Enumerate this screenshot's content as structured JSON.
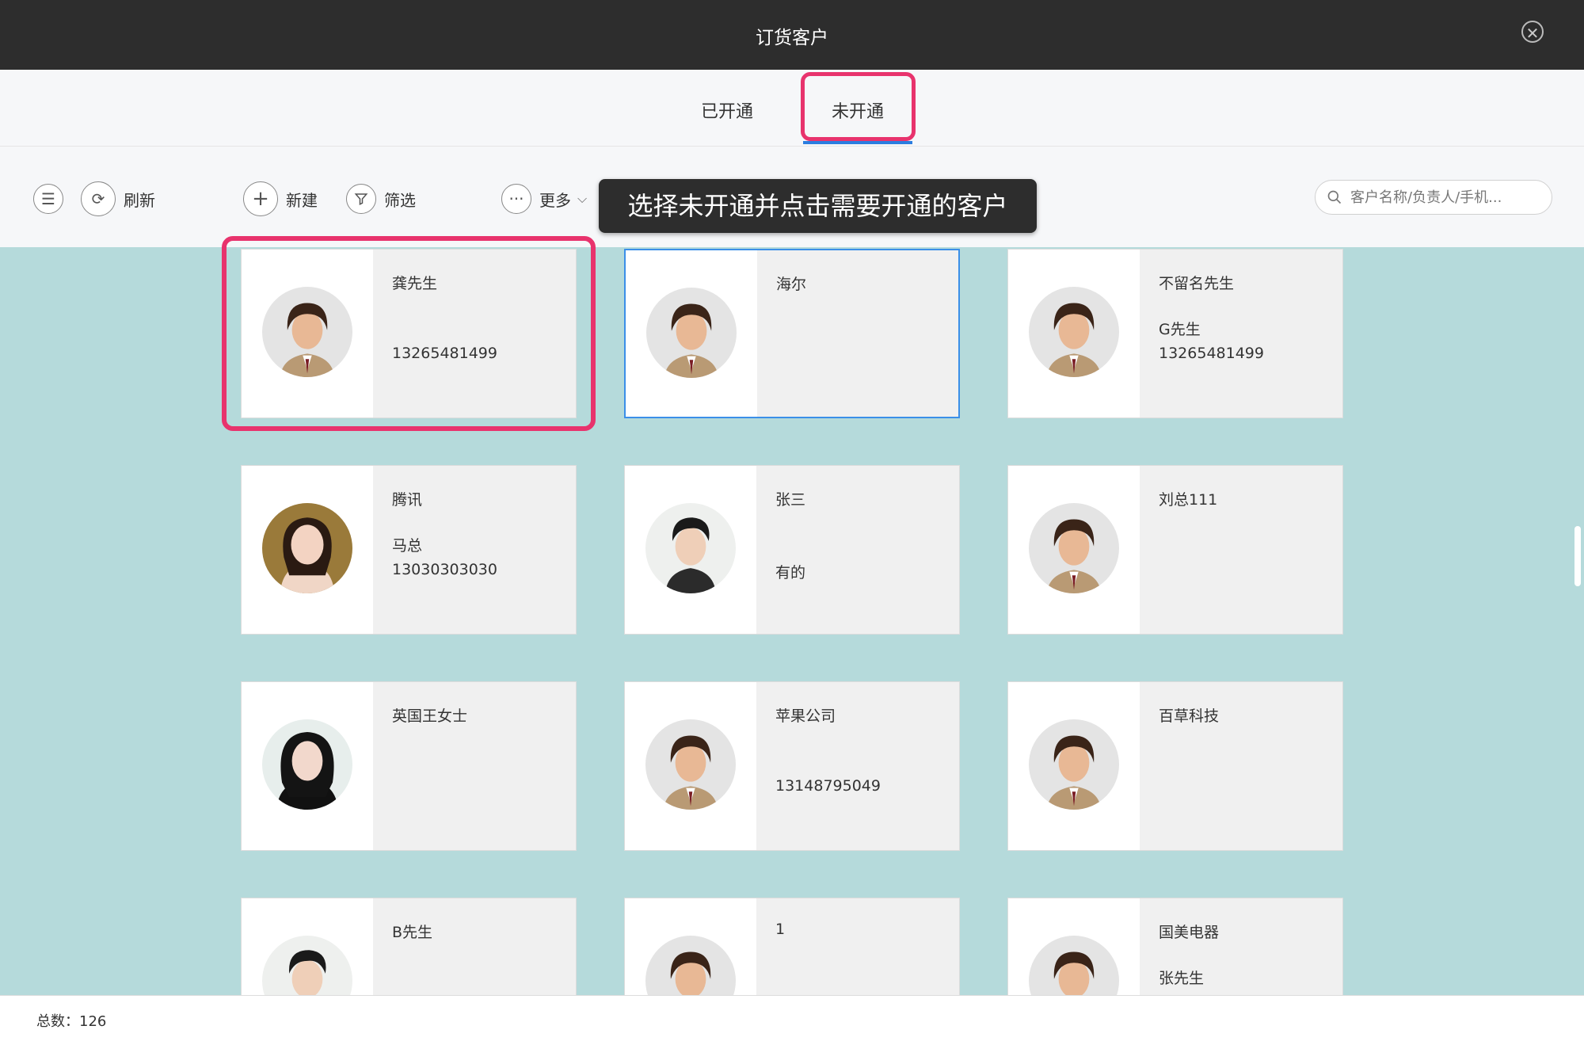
{
  "window": {
    "title": "订货客户"
  },
  "tabs": [
    {
      "label": "已开通",
      "active": false
    },
    {
      "label": "未开通",
      "active": true
    }
  ],
  "toolbar": {
    "refresh_label": "刷新",
    "new_label": "新建",
    "filter_label": "筛选",
    "more_label": "更多",
    "search_placeholder": "客户名称/负责人/手机..."
  },
  "tooltip": {
    "text": "选择未开通并点击需要开通的客户"
  },
  "customers": [
    {
      "name": "龚先生",
      "line2": "",
      "line3": "13265481499",
      "avatar": "man-avatar"
    },
    {
      "name": "海尔",
      "line2": "",
      "line3": "",
      "avatar": "man-avatar",
      "selected": true
    },
    {
      "name": "不留名先生",
      "line2": "G先生",
      "line3": "13265481499",
      "avatar": "man-avatar"
    },
    {
      "name": "腾讯",
      "line2": "马总",
      "line3": "13030303030",
      "avatar": "woman-avatar"
    },
    {
      "name": "张三",
      "line2": "",
      "line3": "有的",
      "avatar": "young-man-avatar"
    },
    {
      "name": "刘总111",
      "line2": "",
      "line3": "",
      "avatar": "man-avatar"
    },
    {
      "name": "英国王女士",
      "line2": "",
      "line3": "",
      "avatar": "woman-dark-hair-avatar"
    },
    {
      "name": "苹果公司",
      "line2": "",
      "line3": "13148795049",
      "avatar": "man-avatar"
    },
    {
      "name": "百草科技",
      "line2": "",
      "line3": "",
      "avatar": "man-avatar"
    },
    {
      "name": "B先生",
      "line2": "",
      "line3": "",
      "avatar": "young-man-avatar"
    },
    {
      "name": "1",
      "line2": "",
      "line3": "",
      "avatar": "man-avatar"
    },
    {
      "name": "国美电器",
      "line2": "张先生",
      "line3": "",
      "avatar": "man-avatar"
    }
  ],
  "footer": {
    "total_label": "总数：126"
  },
  "colors": {
    "highlight": "#e8336d",
    "tab_underline": "#2b7de0",
    "content_bg": "#b5dadb",
    "titlebar_bg": "#2d2d2d"
  }
}
